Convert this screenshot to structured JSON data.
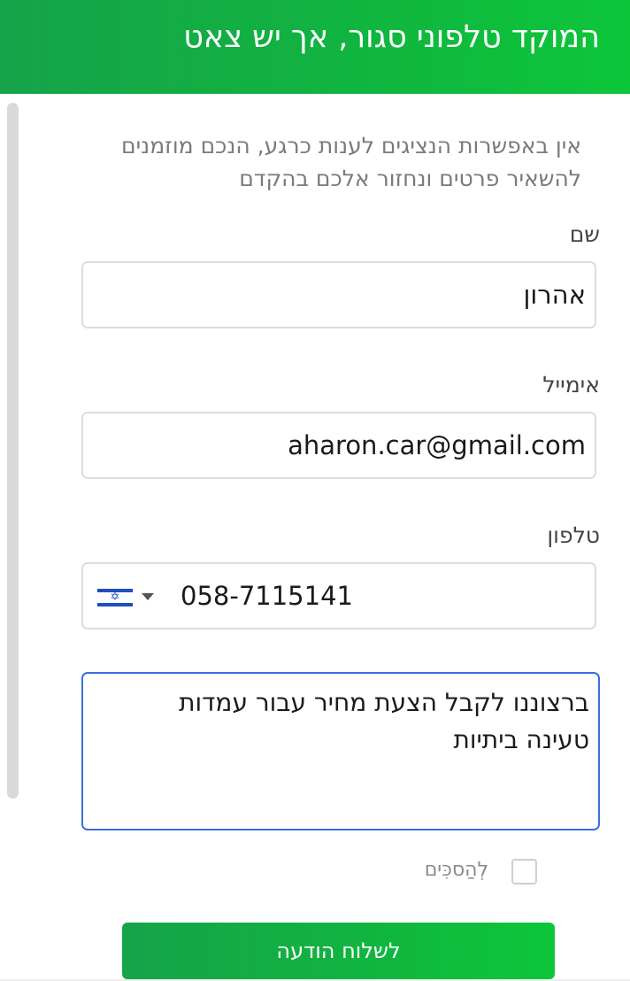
{
  "header": {
    "title": "המוקד טלפוני סגור, אך יש צאט"
  },
  "info": {
    "text": "אין באפשרות הנציגים לענות כרגע, הנכם מוזמנים להשאיר פרטים ונחזור אלכם בהקדם"
  },
  "form": {
    "name_label": "שם",
    "name_value": "אהרון",
    "email_label": "אימייל",
    "email_value": "aharon.car@gmail.com",
    "phone_label": "טלפון",
    "phone_value": "058-7115141",
    "phone_country_icon": "israel-flag-icon",
    "message_value": "ברצוננו לקבל הצעת מחיר עבור עמדות טעינה ביתיות",
    "agree_label": "לְהַסכִּים",
    "send_label": "לשלוח הודעה"
  },
  "colors": {
    "accent_green": "#16a34a",
    "focus_blue": "#3a6fe0"
  }
}
